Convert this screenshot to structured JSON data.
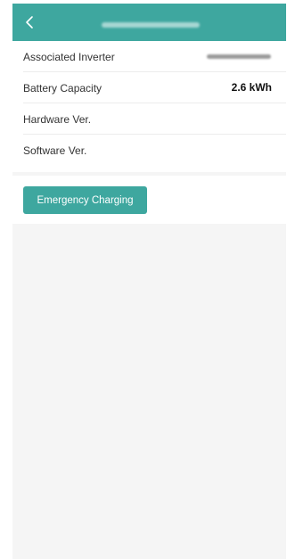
{
  "header": {
    "back_icon": "chevron-left-icon",
    "title": "",
    "colors": {
      "header_bg": "#3ea79f"
    }
  },
  "details": {
    "rows": [
      {
        "label": "Associated Inverter",
        "value": ""
      },
      {
        "label": "Battery Capacity",
        "value": "2.6 kWh"
      },
      {
        "label": "Hardware Ver.",
        "value": ""
      },
      {
        "label": "Software Ver.",
        "value": ""
      }
    ]
  },
  "actions": {
    "emergency_charging_label": "Emergency Charging",
    "button_color": "#3ea79f"
  }
}
